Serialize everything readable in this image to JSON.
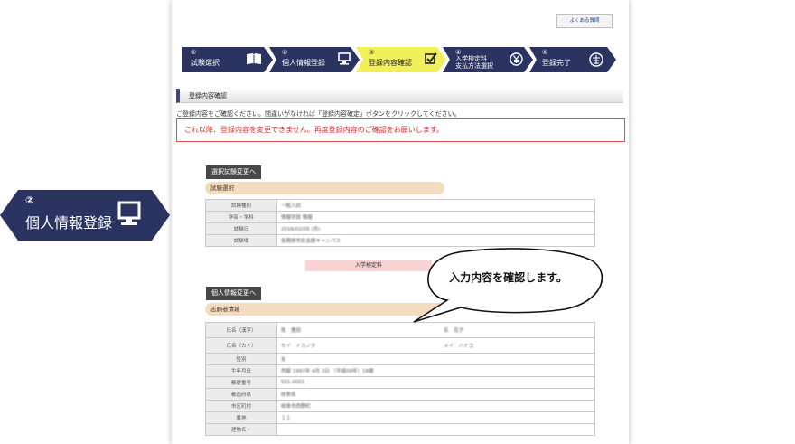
{
  "toolbar": {
    "faq_label": "よくある質問"
  },
  "steps": [
    {
      "num": "①",
      "label": "試験選択",
      "icon": "book-icon"
    },
    {
      "num": "②",
      "label": "個人情報登録",
      "icon": "computer-icon"
    },
    {
      "num": "③",
      "label": "登録内容確認",
      "icon": "checkbox-icon",
      "active": true
    },
    {
      "num": "④",
      "label_line1": "入学検定料",
      "label_line2": "支払方法選択",
      "icon": "yen-icon"
    },
    {
      "num": "⑤",
      "label": "登録完了",
      "icon": "completed-stamp-icon"
    }
  ],
  "section": {
    "title": "登録内容確認"
  },
  "instruction": "ご登録内容をご確認ください。間違いがなければ「登録内容確定」ボタンをクリックしてください。",
  "warning": "これ以降、登録内容を変更できません。再度登録内容のご確認をお願いします。",
  "exam": {
    "change_button": "選択試験変更へ",
    "category": "試験選択",
    "rows": [
      {
        "key": "試験種別",
        "value": "一般入試"
      },
      {
        "key": "学部・学科",
        "value": "情報学部 情報"
      },
      {
        "key": "試験日",
        "value": "2016/02/05 (月)"
      },
      {
        "key": "試験場",
        "value": "各務原市民会館キャンパス"
      }
    ]
  },
  "fee": {
    "label": "入学検定料"
  },
  "personal": {
    "change_button": "個人情報変更へ",
    "category": "志願者情報",
    "name_kanji": {
      "key": "氏名（漢字）",
      "sei_label": "姓",
      "sei": "豊田",
      "mei_label": "名",
      "mei": "花子"
    },
    "name_kana": {
      "key": "氏名（カナ）",
      "sei_label": "セイ",
      "sei": "トヨノタ",
      "mei_label": "メイ",
      "mei": "ハナコ"
    },
    "rows": [
      {
        "key": "性別",
        "value": "女"
      },
      {
        "key": "生年月日",
        "value": "西暦 1997年 4月 3日 （平成09年）18歳"
      },
      {
        "key": "郵便番号",
        "value": "501-0001"
      },
      {
        "key": "都道府県",
        "value": "岐阜県"
      },
      {
        "key": "市区町村",
        "value": "岐阜市西野町"
      },
      {
        "key": "番地",
        "value": "１１"
      },
      {
        "key": "建物名・",
        "value": ""
      }
    ]
  },
  "callout": {
    "step_num": "②",
    "step_label": "個人情報登録",
    "icon": "computer-icon"
  },
  "bubble": {
    "text": "入力内容を確認します。"
  },
  "colors": {
    "navy": "#2b3461",
    "active_step": "#f1f05a",
    "warning": "#d03030"
  }
}
